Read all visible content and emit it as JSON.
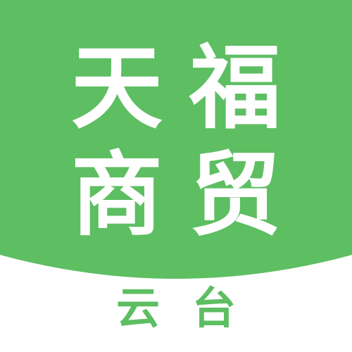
{
  "logo": {
    "title_line_1": [
      "天",
      "福"
    ],
    "title_line_2": [
      "商",
      "贸"
    ],
    "subtitle": [
      "云",
      "台"
    ]
  },
  "colors": {
    "brand_green": "#5dbe62",
    "background": "#ffffff",
    "title_text": "#ffffff",
    "subtitle_text": "#5dbe62"
  }
}
